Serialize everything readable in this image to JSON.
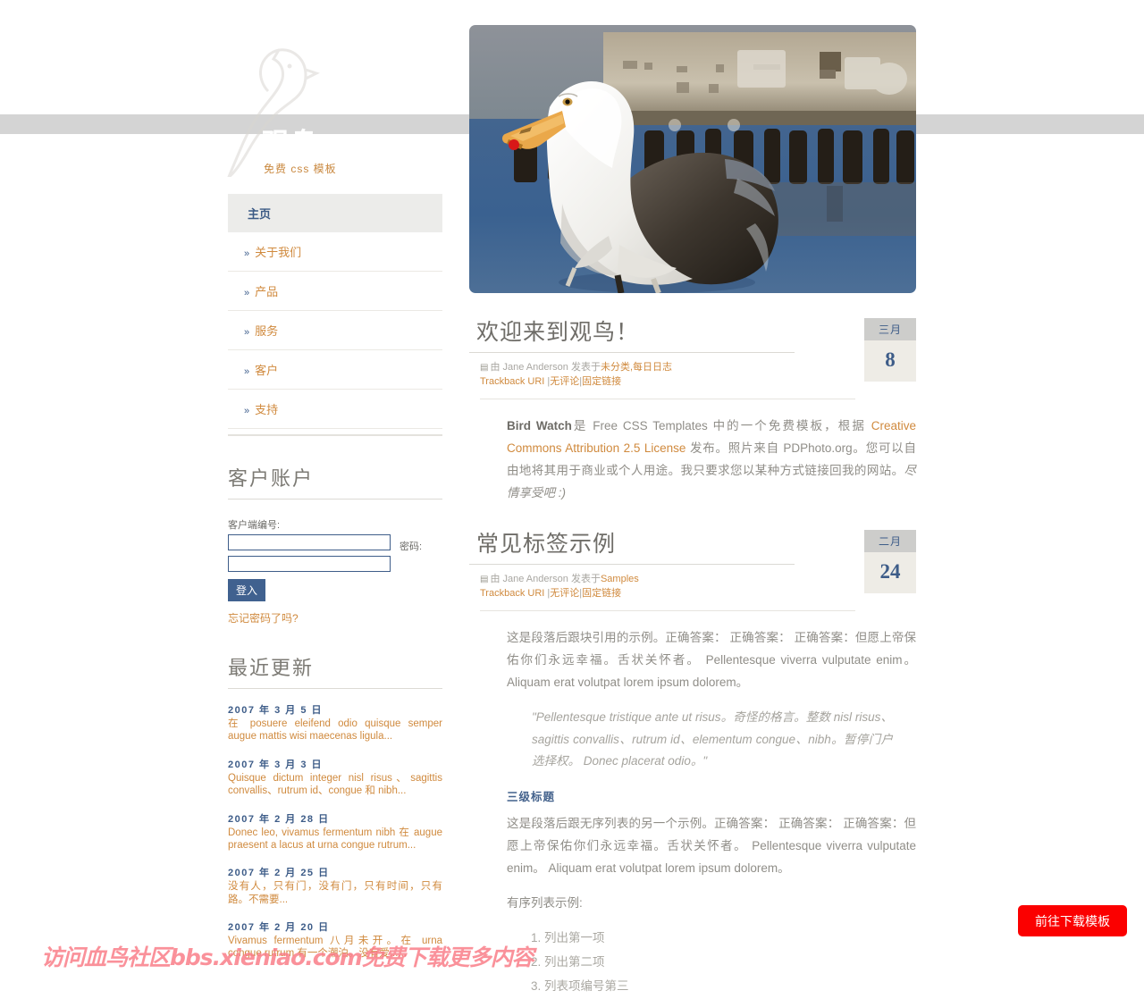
{
  "site": {
    "title": "观鸟",
    "tagline": "免费 css 模板",
    "logo_icon": "bird-outline-icon"
  },
  "nav": {
    "items": [
      {
        "label": "主页",
        "active": true
      },
      {
        "label": "关于我们",
        "active": false
      },
      {
        "label": "产品",
        "active": false
      },
      {
        "label": "服务",
        "active": false
      },
      {
        "label": "客户",
        "active": false
      },
      {
        "label": "支持",
        "active": false
      }
    ],
    "arrow_glyph": "»"
  },
  "account": {
    "title": "客户账户",
    "client_id_label": "客户端编号:",
    "client_id_value": "",
    "client_id_placeholder": "",
    "password_label": "密码:",
    "password_value": "",
    "password_placeholder": "",
    "login_button": "登入",
    "forgot_link": "忘记密码了吗?"
  },
  "updates": {
    "title": "最近更新",
    "items": [
      {
        "date": "2007 年 3 月 5 日",
        "text": "在 posuere eleifend odio quisque semper augue mattis wisi maecenas ligula..."
      },
      {
        "date": "2007 年 3 月 3 日",
        "text": "Quisque dictum integer nisl risus、sagittis convallis、rutrum id、congue 和 nibh..."
      },
      {
        "date": "2007 年 2 月 28 日",
        "text": "Donec leo, vivamus fermentum nibh 在 augue praesent a lacus at urna congue rutrum..."
      },
      {
        "date": "2007 年 2 月 25 日",
        "text": "没有人，只有门，没有门，只有时间，只有路。不需要..."
      },
      {
        "date": "2007 年 2 月 20 日",
        "text": "Vivamus fermentum 八月未开。在 urna congue rutrum 有一个潮泊。没有爱......"
      }
    ]
  },
  "hero": {
    "alt": "seagull-photo"
  },
  "posts": [
    {
      "title": "欢迎来到观鸟！",
      "month": "三月",
      "day": "8",
      "meta_prefix": "由 Jane Anderson 发表于",
      "categories": "未分类,每日日志",
      "trackback": "Trackback URI",
      "comments": "无评论",
      "permalink": "固定链接",
      "body_lead": "Bird Watch",
      "body_part1": "是 Free CSS Templates 中的一个免费模板，根据 ",
      "body_link": "Creative Commons Attribution 2.5 License",
      "body_part2": " 发布。照片来自 PDPhoto.org。您可以自由地将其用于商业或个人用途。我只要求您以某种方式链接回我的网站。",
      "body_em": "尽情享受吧 :)"
    },
    {
      "title": "常见标签示例",
      "month": "二月",
      "day": "24",
      "meta_prefix": "由 Jane Anderson 发表于",
      "categories": "Samples",
      "trackback": "Trackback URI",
      "comments": "无评论",
      "permalink": "固定链接",
      "para1": "这是段落后跟块引用的示例。正确答案： 正确答案： 正确答案：但愿上帝保佑你们永远幸福。舌状关怀者。 Pellentesque viverra vulputate enim。 Aliquam erat volutpat lorem ipsum dolorem。",
      "quote": "\"Pellentesque tristique ante ut risus。奇怪的格言。整数 nisl risus、sagittis convallis、rutrum id、elementum congue、nibh。暂停门户选择权。 Donec placerat odio。\"",
      "sub_head": "三级标题",
      "para2": "这是段落后跟无序列表的另一个示例。正确答案： 正确答案： 正确答案：但愿上帝保佑你们永远幸福。舌状关怀者。 Pellentesque viverra vulputate enim。 Aliquam erat volutpat lorem ipsum dolorem。",
      "list_intro": "有序列表示例:",
      "list_items": [
        "列出第一项",
        "列出第二项",
        "列表项编号第三"
      ]
    }
  ],
  "overlay": {
    "watermark": "访问血鸟社区bbs.xieniao.com免费下载更多内容",
    "download_button": "前往下载模板"
  },
  "colors": {
    "accent_orange": "#d08a3e",
    "accent_blue": "#3d5c88",
    "band_gray": "#d4d4d4",
    "badge_gray": "#cdcdcb",
    "badge_cream": "#eeece6",
    "watermark_pink": "#fa7e89",
    "download_red": "#fb0000"
  }
}
